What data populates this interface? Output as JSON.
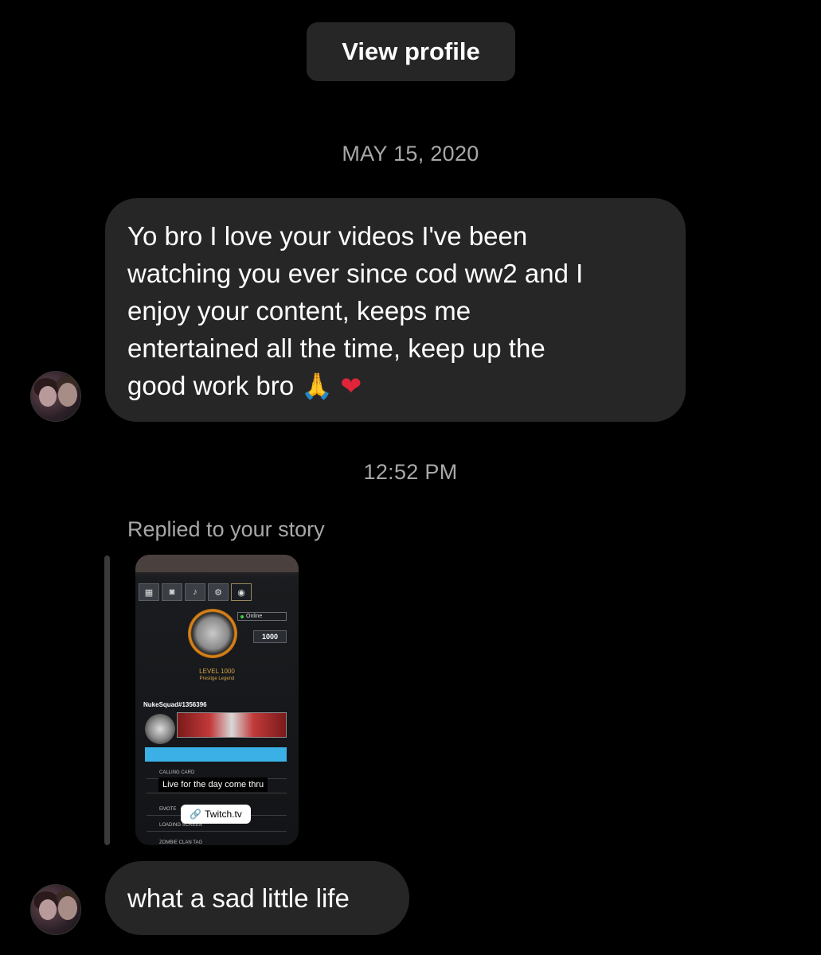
{
  "header": {
    "view_profile_label": "View profile"
  },
  "thread": {
    "date_separator": "MAY 15, 2020",
    "time_separator": "12:52 PM",
    "message_1": {
      "lines": [
        "Yo bro I love your videos I've been",
        "watching you ever since cod ww2 and I",
        "enjoy your content, keeps me",
        "entertained all the time, keep up the",
        "good work bro"
      ],
      "emoji_pray": "🙏",
      "emoji_heart": "❤"
    },
    "reply_label": "Replied to your story",
    "story": {
      "online_status": "Online",
      "coins": "1000",
      "level": "LEVEL 1000",
      "rank": "Prestige Legend",
      "player_tag": "NukeSquad#1356396",
      "menu_rows": [
        "CALLING CARD",
        "",
        "EMOTE",
        "LOADING SCREEN",
        "ZOMBIE CLAN TAG"
      ],
      "caption": "Live for the day come thru",
      "link_text": "Twitch.tv"
    },
    "message_2": "what a sad little life"
  }
}
